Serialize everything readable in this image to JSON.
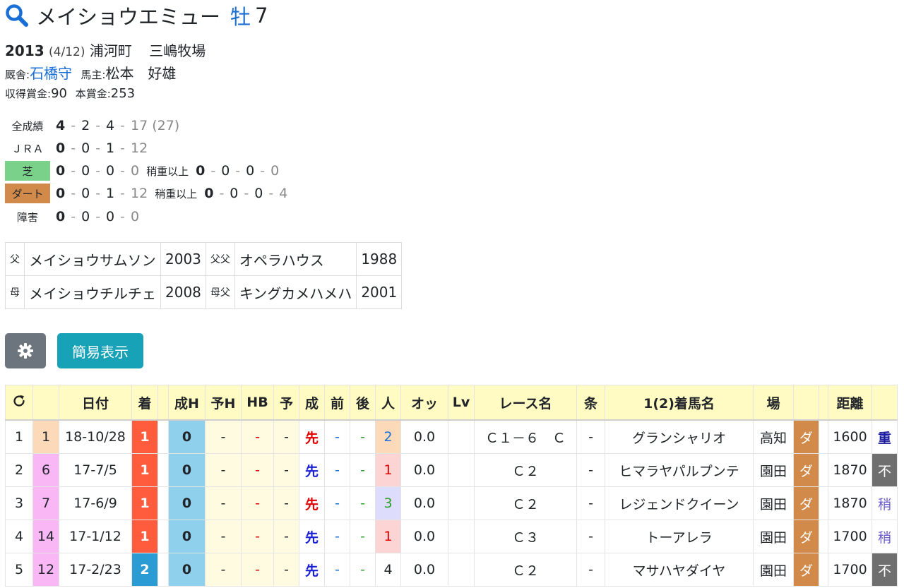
{
  "horse": {
    "name": "メイショウエミュー",
    "sex": "牡",
    "age": "7"
  },
  "birth": {
    "year": "2013",
    "date": "(4/12)",
    "place": "浦河町",
    "farm": "三嶋牧場"
  },
  "stable": {
    "trainer_label": "厩舎:",
    "trainer": "石橋守",
    "owner_label": "馬主:",
    "owner": "松本　好雄"
  },
  "prize": {
    "earned_label": "収得賞金:",
    "earned": "90",
    "main_label": "本賞金:",
    "main": "253"
  },
  "records": {
    "all": {
      "label": "全成績",
      "w": "4",
      "s": "2",
      "t": "4",
      "o": "17",
      "total": "(27)"
    },
    "jra": {
      "label": "ＪＲＡ",
      "w": "0",
      "s": "0",
      "t": "1",
      "o": "12"
    },
    "turf": {
      "label": "芝",
      "w": "0",
      "s": "0",
      "t": "0",
      "o": "0",
      "sub_label": "稍重以上",
      "sw": "0",
      "ss": "0",
      "st": "0",
      "so": "0"
    },
    "dirt": {
      "label": "ダート",
      "w": "0",
      "s": "0",
      "t": "1",
      "o": "12",
      "sub_label": "稍重以上",
      "sw": "0",
      "ss": "0",
      "st": "0",
      "so": "4"
    },
    "hurdle": {
      "label": "障害",
      "w": "0",
      "s": "0",
      "t": "0",
      "o": "0"
    }
  },
  "pedigree": {
    "sire_label": "父",
    "sire": "メイショウサムソン",
    "sire_year": "2003",
    "sire_sire_label": "父父",
    "sire_sire": "オペラハウス",
    "sire_sire_year": "1988",
    "dam_label": "母",
    "dam": "メイショウチルチェ",
    "dam_year": "2008",
    "dam_sire_label": "母父",
    "dam_sire": "キングカメハメハ",
    "dam_sire_year": "2001"
  },
  "buttons": {
    "settings_icon": "gear-icon",
    "simple_view": "簡易表示"
  },
  "table": {
    "headers": [
      "",
      "",
      "日付",
      "着",
      "",
      "成H",
      "予H",
      "HB",
      "予",
      "成",
      "前",
      "後",
      "人",
      "オッ",
      "Lv",
      "レース名",
      "条",
      "1(2)着馬名",
      "場",
      "",
      "",
      "距離",
      ""
    ],
    "rows": [
      {
        "no": "1",
        "waku": "1",
        "date": "18-10/28",
        "rank": "1",
        "sei_h": "0",
        "yo_h": "-",
        "hb": "-",
        "yo": "-",
        "sei": "先",
        "mae": "-",
        "ato": "-",
        "nin": "2",
        "odds": "0.0",
        "lv": "",
        "race": "Ｃ１－６　Ｃ",
        "jou": "-",
        "winner": "グランシャリオ",
        "place": "高知",
        "surface": "ダ",
        "dist": "1600",
        "cond": "重"
      },
      {
        "no": "2",
        "waku": "6",
        "date": "17-7/5",
        "rank": "1",
        "sei_h": "0",
        "yo_h": "-",
        "hb": "-",
        "yo": "-",
        "sei": "先",
        "mae": "-",
        "ato": "-",
        "nin": "1",
        "odds": "0.0",
        "lv": "",
        "race": "Ｃ２",
        "jou": "-",
        "winner": "ヒマラヤパルプンテ",
        "place": "園田",
        "surface": "ダ",
        "dist": "1870",
        "cond": "不"
      },
      {
        "no": "3",
        "waku": "7",
        "date": "17-6/9",
        "rank": "1",
        "sei_h": "0",
        "yo_h": "-",
        "hb": "-",
        "yo": "-",
        "sei": "先",
        "mae": "-",
        "ato": "-",
        "nin": "3",
        "odds": "0.0",
        "lv": "",
        "race": "Ｃ２",
        "jou": "-",
        "winner": "レジェンドクイーン",
        "place": "園田",
        "surface": "ダ",
        "dist": "1870",
        "cond": "稍"
      },
      {
        "no": "4",
        "waku": "14",
        "date": "17-1/12",
        "rank": "1",
        "sei_h": "0",
        "yo_h": "-",
        "hb": "-",
        "yo": "-",
        "sei": "先",
        "mae": "-",
        "ato": "-",
        "nin": "1",
        "odds": "0.0",
        "lv": "",
        "race": "Ｃ３",
        "jou": "-",
        "winner": "トーアレラ",
        "place": "園田",
        "surface": "ダ",
        "dist": "1700",
        "cond": "稍"
      },
      {
        "no": "5",
        "waku": "12",
        "date": "17-2/23",
        "rank": "2",
        "sei_h": "0",
        "yo_h": "-",
        "hb": "-",
        "yo": "-",
        "sei": "先",
        "mae": "-",
        "ato": "-",
        "nin": "4",
        "odds": "0.0",
        "lv": "",
        "race": "Ｃ２",
        "jou": "-",
        "winner": "マサハヤダイヤ",
        "place": "園田",
        "surface": "ダ",
        "dist": "1700",
        "cond": "不"
      }
    ]
  },
  "colors": {
    "accent": "#1a6fd6",
    "header_bg": "#fffbc2",
    "rank1": "#fe5c3c",
    "rank2": "#2b9bd4",
    "dirt": "#d28a4a",
    "turf": "#7ad28a",
    "simple_btn": "#17a2b8",
    "gear_btn": "#6c757d"
  }
}
